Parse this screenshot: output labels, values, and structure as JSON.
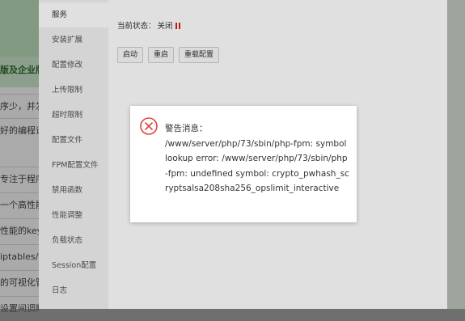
{
  "background": {
    "heading": "版及企业版",
    "rows": [
      "序少，并发能",
      "好的编程语言",
      "专注于程序",
      "一个高性能的",
      "性能的key-va",
      "iptables/fir",
      "的可视化管理",
      "设置间调断本"
    ]
  },
  "sidebar": {
    "items": [
      {
        "label": "服务",
        "active": true
      },
      {
        "label": "安装扩展"
      },
      {
        "label": "配置修改"
      },
      {
        "label": "上传限制"
      },
      {
        "label": "超时限制"
      },
      {
        "label": "配置文件"
      },
      {
        "label": "FPM配置文件"
      },
      {
        "label": "禁用函数"
      },
      {
        "label": "性能调整"
      },
      {
        "label": "负载状态"
      },
      {
        "label": "Session配置"
      },
      {
        "label": "日志"
      }
    ]
  },
  "main": {
    "status_label": "当前状态：",
    "status_value": "关闭",
    "status_color": "#d81e06",
    "buttons": {
      "start": "启动",
      "restart": "重启",
      "reload": "重载配置"
    }
  },
  "alert": {
    "icon": "error-circle-icon",
    "icon_color": "#e0453a",
    "title": "警告消息：",
    "message": "/www/server/php/73/sbin/php-fpm: symbol lookup error: /www/server/php/73/sbin/php-fpm: undefined symbol: crypto_pwhash_scryptsalsa208sha256_opslimit_interactive"
  }
}
